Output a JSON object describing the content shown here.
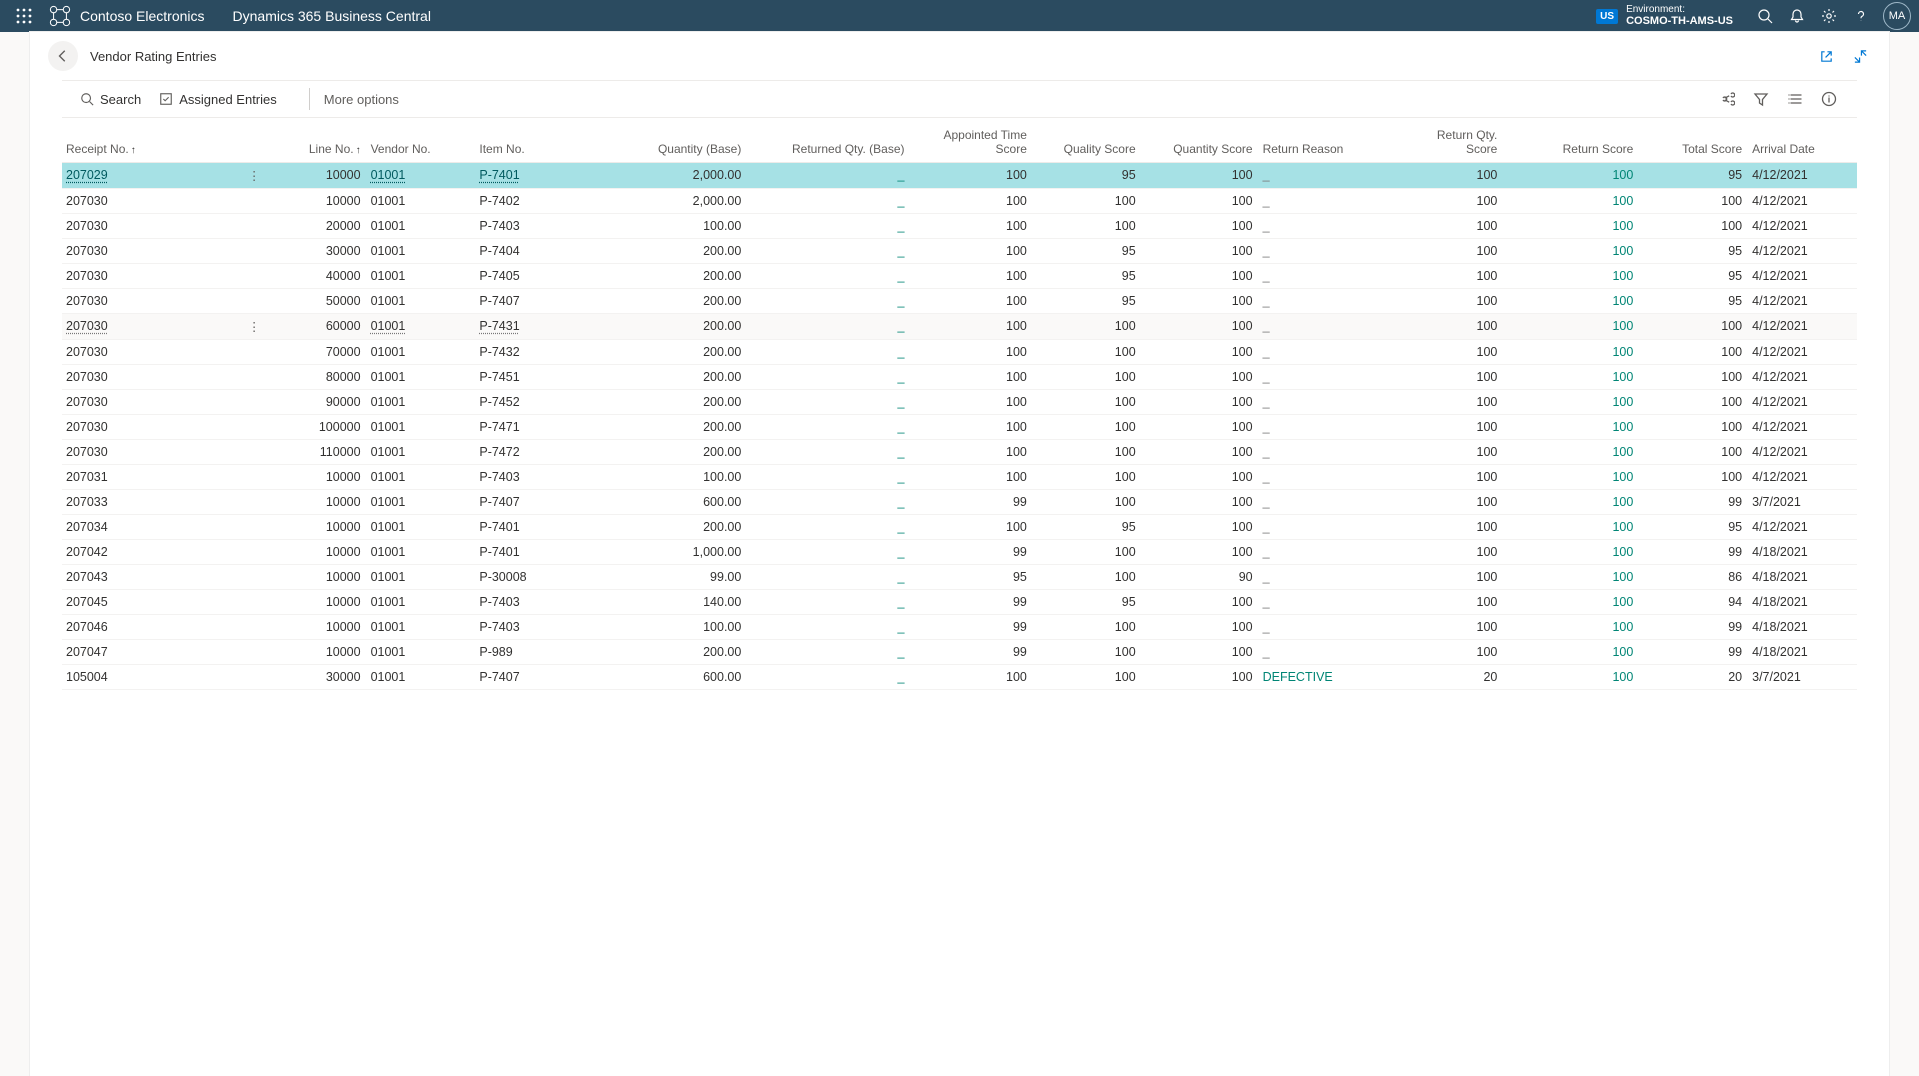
{
  "topnav": {
    "company": "Contoso Electronics",
    "product": "Dynamics 365 Business Central",
    "env_badge": "US",
    "env_label": "Environment:",
    "env_name": "COSMO-TH-AMS-US",
    "avatar": "MA"
  },
  "page": {
    "title": "Vendor Rating Entries"
  },
  "toolbar": {
    "search": "Search",
    "assigned": "Assigned Entries",
    "more": "More options"
  },
  "columns": {
    "receipt": "Receipt No.",
    "line": "Line No.",
    "vendor": "Vendor No.",
    "item": "Item No.",
    "qty": "Quantity (Base)",
    "rqty": "Returned Qty. (Base)",
    "ats": "Appointed Time Score",
    "quality": "Quality Score",
    "qtyscore": "Quantity Score",
    "reason": "Return Reason",
    "rqtyscore": "Return Qty. Score",
    "rscore": "Return Score",
    "total": "Total Score",
    "arrival": "Arrival Date"
  },
  "rows": [
    {
      "receipt": "207029",
      "line": "10000",
      "vendor": "01001",
      "item": "P-7401",
      "qty": "2,000.00",
      "rqty": "_",
      "ats": "100",
      "quality": "95",
      "qtyscore": "100",
      "reason": "_",
      "rqtyscore": "100",
      "rscore": "100",
      "total": "95",
      "arrival": "4/12/2021",
      "selected": true
    },
    {
      "receipt": "207030",
      "line": "10000",
      "vendor": "01001",
      "item": "P-7402",
      "qty": "2,000.00",
      "rqty": "_",
      "ats": "100",
      "quality": "100",
      "qtyscore": "100",
      "reason": "_",
      "rqtyscore": "100",
      "rscore": "100",
      "total": "100",
      "arrival": "4/12/2021"
    },
    {
      "receipt": "207030",
      "line": "20000",
      "vendor": "01001",
      "item": "P-7403",
      "qty": "100.00",
      "rqty": "_",
      "ats": "100",
      "quality": "100",
      "qtyscore": "100",
      "reason": "_",
      "rqtyscore": "100",
      "rscore": "100",
      "total": "100",
      "arrival": "4/12/2021"
    },
    {
      "receipt": "207030",
      "line": "30000",
      "vendor": "01001",
      "item": "P-7404",
      "qty": "200.00",
      "rqty": "_",
      "ats": "100",
      "quality": "95",
      "qtyscore": "100",
      "reason": "_",
      "rqtyscore": "100",
      "rscore": "100",
      "total": "95",
      "arrival": "4/12/2021"
    },
    {
      "receipt": "207030",
      "line": "40000",
      "vendor": "01001",
      "item": "P-7405",
      "qty": "200.00",
      "rqty": "_",
      "ats": "100",
      "quality": "95",
      "qtyscore": "100",
      "reason": "_",
      "rqtyscore": "100",
      "rscore": "100",
      "total": "95",
      "arrival": "4/12/2021"
    },
    {
      "receipt": "207030",
      "line": "50000",
      "vendor": "01001",
      "item": "P-7407",
      "qty": "200.00",
      "rqty": "_",
      "ats": "100",
      "quality": "95",
      "qtyscore": "100",
      "reason": "_",
      "rqtyscore": "100",
      "rscore": "100",
      "total": "95",
      "arrival": "4/12/2021"
    },
    {
      "receipt": "207030",
      "line": "60000",
      "vendor": "01001",
      "item": "P-7431",
      "qty": "200.00",
      "rqty": "_",
      "ats": "100",
      "quality": "100",
      "qtyscore": "100",
      "reason": "_",
      "rqtyscore": "100",
      "rscore": "100",
      "total": "100",
      "arrival": "4/12/2021",
      "hovered": true
    },
    {
      "receipt": "207030",
      "line": "70000",
      "vendor": "01001",
      "item": "P-7432",
      "qty": "200.00",
      "rqty": "_",
      "ats": "100",
      "quality": "100",
      "qtyscore": "100",
      "reason": "_",
      "rqtyscore": "100",
      "rscore": "100",
      "total": "100",
      "arrival": "4/12/2021"
    },
    {
      "receipt": "207030",
      "line": "80000",
      "vendor": "01001",
      "item": "P-7451",
      "qty": "200.00",
      "rqty": "_",
      "ats": "100",
      "quality": "100",
      "qtyscore": "100",
      "reason": "_",
      "rqtyscore": "100",
      "rscore": "100",
      "total": "100",
      "arrival": "4/12/2021"
    },
    {
      "receipt": "207030",
      "line": "90000",
      "vendor": "01001",
      "item": "P-7452",
      "qty": "200.00",
      "rqty": "_",
      "ats": "100",
      "quality": "100",
      "qtyscore": "100",
      "reason": "_",
      "rqtyscore": "100",
      "rscore": "100",
      "total": "100",
      "arrival": "4/12/2021"
    },
    {
      "receipt": "207030",
      "line": "100000",
      "vendor": "01001",
      "item": "P-7471",
      "qty": "200.00",
      "rqty": "_",
      "ats": "100",
      "quality": "100",
      "qtyscore": "100",
      "reason": "_",
      "rqtyscore": "100",
      "rscore": "100",
      "total": "100",
      "arrival": "4/12/2021"
    },
    {
      "receipt": "207030",
      "line": "110000",
      "vendor": "01001",
      "item": "P-7472",
      "qty": "200.00",
      "rqty": "_",
      "ats": "100",
      "quality": "100",
      "qtyscore": "100",
      "reason": "_",
      "rqtyscore": "100",
      "rscore": "100",
      "total": "100",
      "arrival": "4/12/2021"
    },
    {
      "receipt": "207031",
      "line": "10000",
      "vendor": "01001",
      "item": "P-7403",
      "qty": "100.00",
      "rqty": "_",
      "ats": "100",
      "quality": "100",
      "qtyscore": "100",
      "reason": "_",
      "rqtyscore": "100",
      "rscore": "100",
      "total": "100",
      "arrival": "4/12/2021"
    },
    {
      "receipt": "207033",
      "line": "10000",
      "vendor": "01001",
      "item": "P-7407",
      "qty": "600.00",
      "rqty": "_",
      "ats": "99",
      "quality": "100",
      "qtyscore": "100",
      "reason": "_",
      "rqtyscore": "100",
      "rscore": "100",
      "total": "99",
      "arrival": "3/7/2021"
    },
    {
      "receipt": "207034",
      "line": "10000",
      "vendor": "01001",
      "item": "P-7401",
      "qty": "200.00",
      "rqty": "_",
      "ats": "100",
      "quality": "95",
      "qtyscore": "100",
      "reason": "_",
      "rqtyscore": "100",
      "rscore": "100",
      "total": "95",
      "arrival": "4/12/2021"
    },
    {
      "receipt": "207042",
      "line": "10000",
      "vendor": "01001",
      "item": "P-7401",
      "qty": "1,000.00",
      "rqty": "_",
      "ats": "99",
      "quality": "100",
      "qtyscore": "100",
      "reason": "_",
      "rqtyscore": "100",
      "rscore": "100",
      "total": "99",
      "arrival": "4/18/2021"
    },
    {
      "receipt": "207043",
      "line": "10000",
      "vendor": "01001",
      "item": "P-30008",
      "qty": "99.00",
      "rqty": "_",
      "ats": "95",
      "quality": "100",
      "qtyscore": "90",
      "reason": "_",
      "rqtyscore": "100",
      "rscore": "100",
      "total": "86",
      "arrival": "4/18/2021"
    },
    {
      "receipt": "207045",
      "line": "10000",
      "vendor": "01001",
      "item": "P-7403",
      "qty": "140.00",
      "rqty": "_",
      "ats": "99",
      "quality": "95",
      "qtyscore": "100",
      "reason": "_",
      "rqtyscore": "100",
      "rscore": "100",
      "total": "94",
      "arrival": "4/18/2021"
    },
    {
      "receipt": "207046",
      "line": "10000",
      "vendor": "01001",
      "item": "P-7403",
      "qty": "100.00",
      "rqty": "_",
      "ats": "99",
      "quality": "100",
      "qtyscore": "100",
      "reason": "_",
      "rqtyscore": "100",
      "rscore": "100",
      "total": "99",
      "arrival": "4/18/2021"
    },
    {
      "receipt": "207047",
      "line": "10000",
      "vendor": "01001",
      "item": "P-989",
      "qty": "200.00",
      "rqty": "_",
      "ats": "99",
      "quality": "100",
      "qtyscore": "100",
      "reason": "_",
      "rqtyscore": "100",
      "rscore": "100",
      "total": "99",
      "arrival": "4/18/2021"
    },
    {
      "receipt": "105004",
      "line": "30000",
      "vendor": "01001",
      "item": "P-7407",
      "qty": "600.00",
      "rqty": "_",
      "ats": "100",
      "quality": "100",
      "qtyscore": "100",
      "reason": "DEFECTIVE",
      "rqtyscore": "20",
      "rscore": "100",
      "total": "20",
      "arrival": "3/7/2021"
    }
  ]
}
